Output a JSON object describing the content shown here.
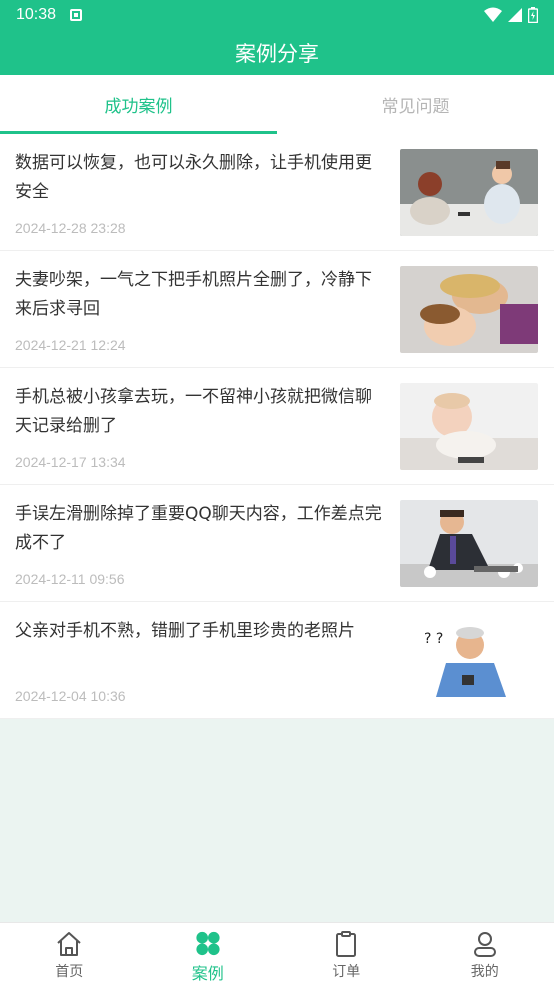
{
  "status": {
    "time": "10:38"
  },
  "header": {
    "title": "案例分享"
  },
  "tabs": [
    {
      "label": "成功案例",
      "active": true
    },
    {
      "label": "常见问题",
      "active": false
    }
  ],
  "cases": [
    {
      "title": "数据可以恢复，也可以永久删除，让手机使用更安全",
      "date": "2024-12-28 23:28"
    },
    {
      "title": "夫妻吵架，一气之下把手机照片全删了，冷静下来后求寻回",
      "date": "2024-12-21 12:24"
    },
    {
      "title": "手机总被小孩拿去玩，一不留神小孩就把微信聊天记录给删了",
      "date": "2024-12-17 13:34"
    },
    {
      "title": "手误左滑删除掉了重要QQ聊天内容，工作差点完成不了",
      "date": "2024-12-11 09:56"
    },
    {
      "title": "父亲对手机不熟，错删了手机里珍贵的老照片",
      "date": "2024-12-04 10:36"
    }
  ],
  "nav": [
    {
      "label": "首页",
      "icon": "home-icon"
    },
    {
      "label": "案例",
      "icon": "grid-icon",
      "active": true
    },
    {
      "label": "订单",
      "icon": "clipboard-icon"
    },
    {
      "label": "我的",
      "icon": "person-icon"
    }
  ],
  "colors": {
    "brand": "#1fc28a",
    "background": "#ebf4f1"
  }
}
